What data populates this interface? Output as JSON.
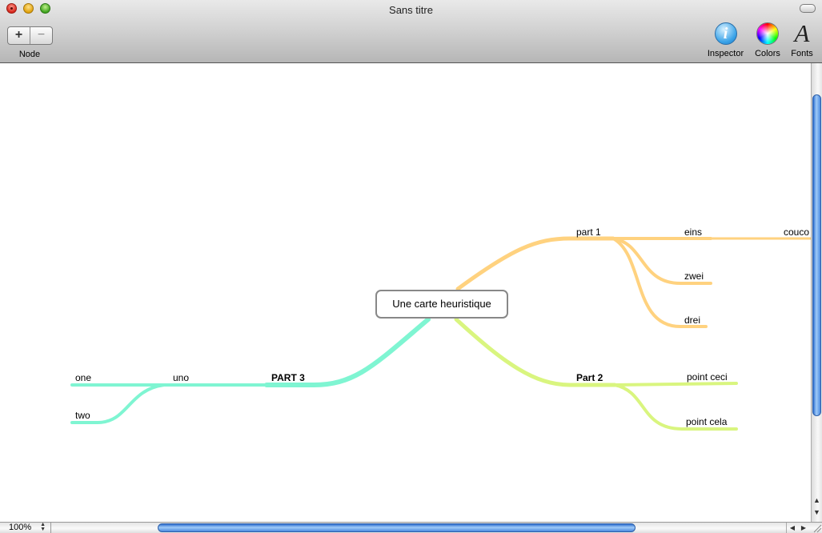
{
  "window": {
    "title": "Sans titre"
  },
  "toolbar": {
    "add_label": "+",
    "remove_label": "−",
    "node_label": "Node",
    "inspector_label": "Inspector",
    "inspector_glyph": "i",
    "colors_label": "Colors",
    "fonts_label": "Fonts",
    "fonts_glyph": "A"
  },
  "mindmap": {
    "root": "Une carte heuristique",
    "branch_colors": {
      "part1": "#ffd27f",
      "part2": "#d9f57f",
      "part3": "#7ff5d2"
    },
    "part1": {
      "label": "part 1",
      "children": [
        "eins",
        "zwei",
        "drei"
      ],
      "eins_child": "couco"
    },
    "part2": {
      "label": "Part 2",
      "children": [
        "point ceci",
        "point cela"
      ]
    },
    "part3": {
      "label": "PART 3",
      "children": [
        "uno"
      ],
      "uno_children": [
        "one",
        "two"
      ]
    }
  },
  "statusbar": {
    "zoom": "100%"
  }
}
